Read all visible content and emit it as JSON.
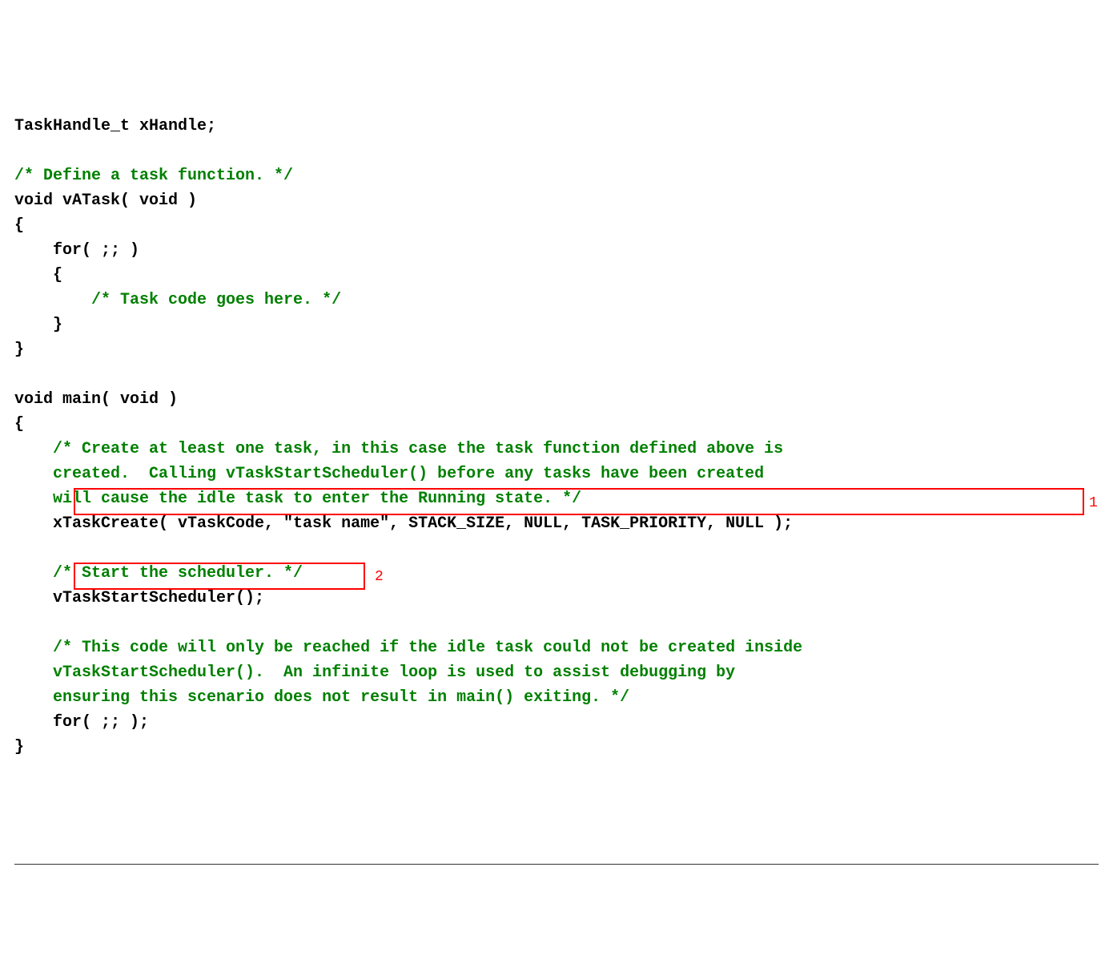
{
  "code": {
    "l01": "TaskHandle_t xHandle;",
    "l02": "",
    "l03": "/* Define a task function. */",
    "l04": "void vATask( void )",
    "l05": "{",
    "l06": "    for( ;; )",
    "l07": "    {",
    "l08": "        /* Task code goes here. */",
    "l09": "    }",
    "l10": "}",
    "l11": "",
    "l12": "void main( void )",
    "l13": "{",
    "l14": "    /* Create at least one task, in this case the task function defined above is",
    "l15": "    created.  Calling vTaskStartScheduler() before any tasks have been created",
    "l16": "    will cause the idle task to enter the Running state. */",
    "l17": "    xTaskCreate( vTaskCode, \"task name\", STACK_SIZE, NULL, TASK_PRIORITY, NULL );",
    "l18": "",
    "l19": "    /* Start the scheduler. */",
    "l20": "    vTaskStartScheduler();",
    "l21": "",
    "l22": "    /* This code will only be reached if the idle task could not be created inside",
    "l23": "    vTaskStartScheduler().  An infinite loop is used to assist debugging by",
    "l24": "    ensuring this scenario does not result in main() exiting. */",
    "l25": "    for( ;; );",
    "l26": "}"
  },
  "annotations": {
    "box1_label": "1",
    "box2_label": "2"
  }
}
